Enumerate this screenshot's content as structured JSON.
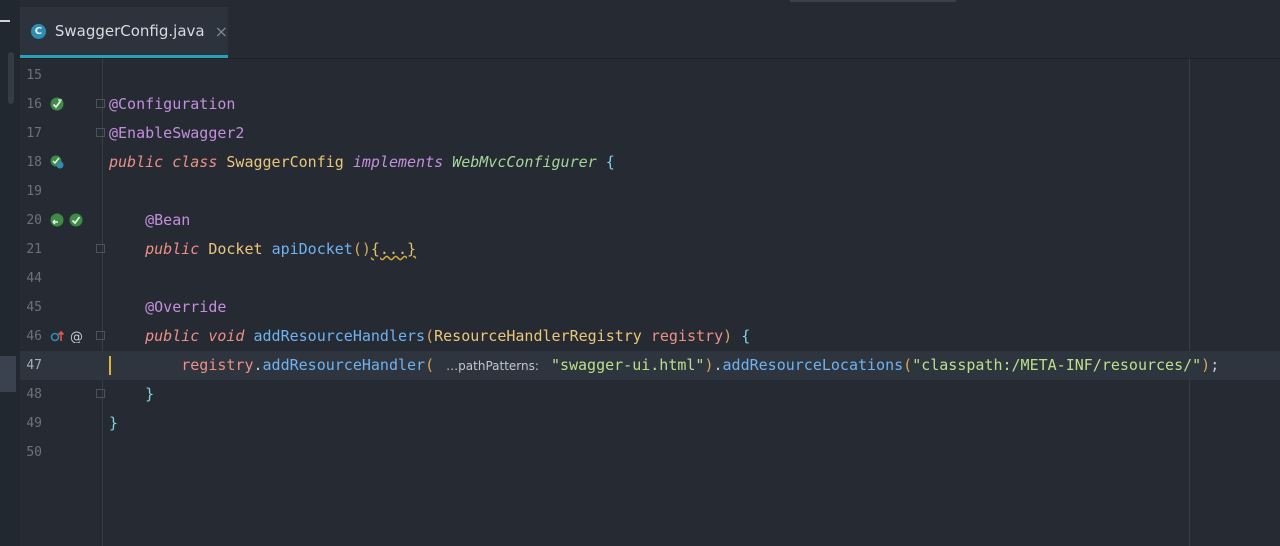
{
  "tab": {
    "label": "SwaggerConfig.java",
    "icon_letter": "C",
    "close_glyph": "×"
  },
  "gutter_icons": {
    "line16": [
      "bean-config-icon"
    ],
    "line18": [
      "bean-class-icon"
    ],
    "line20": [
      "navigate-bean-icon",
      "bean-config-icon"
    ],
    "line46": [
      "override-up-icon",
      "at-symbol-icon"
    ]
  },
  "lines": {
    "l15": {
      "num": "15"
    },
    "l16": {
      "num": "16",
      "ann": "@Configuration"
    },
    "l17": {
      "num": "17",
      "ann": "@EnableSwagger2"
    },
    "l18": {
      "num": "18",
      "kw1": "public",
      "kw2": "class",
      "cls": "SwaggerConfig",
      "kw3": "implements",
      "iface": "WebMvcConfigurer",
      "brace": "{"
    },
    "l19": {
      "num": "19"
    },
    "l20": {
      "num": "20",
      "ann": "@Bean"
    },
    "l21": {
      "num": "21",
      "kw1": "public",
      "cls": "Docket",
      "fn": "apiDocket",
      "paren": "()",
      "folded": "{...}"
    },
    "l44": {
      "num": "44"
    },
    "l45": {
      "num": "45",
      "ann": "@Override"
    },
    "l46": {
      "num": "46",
      "kw1": "public",
      "kw2": "void",
      "fn": "addResourceHandlers",
      "p_open": "(",
      "cls": "ResourceHandlerRegistry",
      "param": "registry",
      "p_close": ")",
      "brace": "{"
    },
    "l47": {
      "num": "47",
      "obj": "registry",
      "dot1": ".",
      "fn1": "addResourceHandler",
      "p_open": "(",
      "hint": "…pathPatterns:",
      "str1": "\"swagger-ui.html\"",
      "p_close": ")",
      "dot2": ".",
      "fn2": "addResourceLocations",
      "p_open2": "(",
      "str2": "\"classpath:/META-INF/resources/\"",
      "p_close2": ")",
      "semi": ";"
    },
    "l48": {
      "num": "48",
      "brace": "}"
    },
    "l49": {
      "num": "49",
      "brace": "}"
    },
    "l50": {
      "num": "50"
    }
  },
  "colors": {
    "accent": "#2a9fb8",
    "caret": "#e0b33b",
    "background": "#262b33"
  }
}
